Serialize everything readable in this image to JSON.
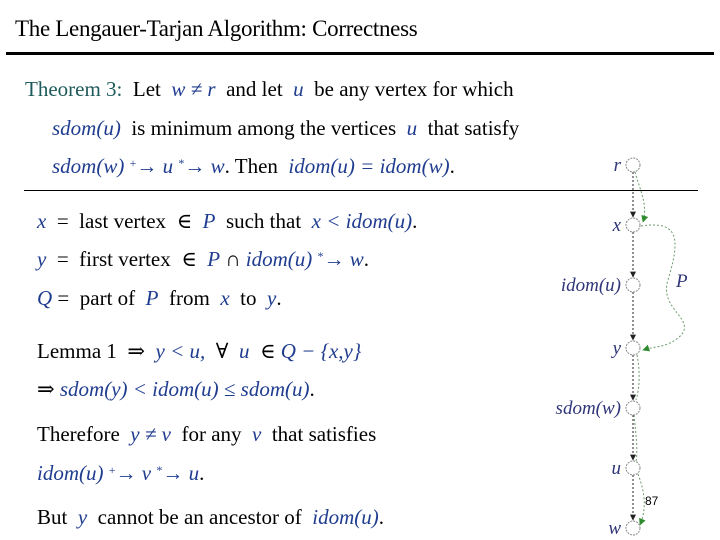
{
  "slide": {
    "title": "The Lengauer-Tarjan Algorithm: Correctness",
    "page_number": "87"
  },
  "theorem": {
    "label": "Theorem 3:",
    "line1": {
      "t1": "Let",
      "m1": "w ≠ r",
      "t2": "and let",
      "m2": "u",
      "t3": "be any vertex for which"
    },
    "line2": {
      "m1": "sdom(u)",
      "t1": "is minimum among the vertices",
      "m2": "u",
      "t2": "that satisfy"
    },
    "line3": {
      "m1": "sdom(w)",
      "sup1": "+",
      "arrow1": "→",
      "m2": "u",
      "sup2": "*",
      "arrow2": "→",
      "m3": "w",
      "t1": ". Then",
      "m4": "idom(u) = idom(w)",
      "t2": "."
    }
  },
  "proof": {
    "x_def": {
      "var": "x",
      "eq": "=",
      "t1": "last vertex",
      "in": "∈",
      "m1": "P",
      "t2": "such that",
      "m2": "x <",
      "m3": "idom(u)",
      "end": "."
    },
    "y_def": {
      "var": "y",
      "eq": "=",
      "t1": "first vertex",
      "in": "∈",
      "m1": "P",
      "cap": "∩",
      "m2": "idom(u)",
      "sup": "*",
      "arrow": "→",
      "m3": "w",
      "end": "."
    },
    "q_def": {
      "var": "Q",
      "eq": "=",
      "t1": "part of",
      "m1": "P",
      "t2": "from",
      "m2": "x",
      "t3": "to",
      "m3": "y",
      "end": "."
    },
    "lemma": {
      "t1": "Lemma 1",
      "implies": "⇒",
      "m1": "y < u,",
      "forall": "∀",
      "m2": "u",
      "in": "∈",
      "m3": "Q − {x,y}"
    },
    "implies_line": {
      "implies": "⇒",
      "m1": "sdom(y) < idom(u) ≤ sdom(u)",
      "end": "."
    },
    "therefore": {
      "t1": "Therefore",
      "m1": "y ≠ v",
      "t2": "for any",
      "m2": "v",
      "t3": "that satisfies"
    },
    "path_line": {
      "m1": "idom(u)",
      "sup1": "+",
      "arrow1": "→",
      "m2": "v",
      "sup2": "*",
      "arrow2": "→",
      "m3": "u",
      "end": "."
    },
    "but": {
      "t1": "But",
      "m1": "y",
      "t2": "cannot be an ancestor of",
      "m2": "idom(u)",
      "end": "."
    }
  },
  "diagram": {
    "nodes": [
      {
        "id": "r",
        "label": "r"
      },
      {
        "id": "x",
        "label": "x"
      },
      {
        "id": "idom_u",
        "label": "idom(u)"
      },
      {
        "id": "y",
        "label": "y"
      },
      {
        "id": "sdom_w",
        "label": "sdom(w)"
      },
      {
        "id": "u",
        "label": "u"
      },
      {
        "id": "w",
        "label": "w"
      }
    ],
    "path_label": "P",
    "tree_edge_color": "#222222",
    "path_edge_color": "#2e8b2e",
    "node_stroke": "#888888"
  }
}
